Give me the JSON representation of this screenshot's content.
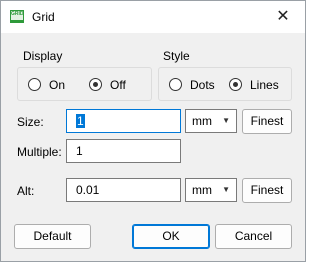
{
  "window": {
    "title": "Grid",
    "close_symbol": "✕",
    "icon_text": "GRID"
  },
  "display": {
    "heading": "Display",
    "option_on": "On",
    "option_off": "Off",
    "selected": "Off"
  },
  "style": {
    "heading": "Style",
    "option_dots": "Dots",
    "option_lines": "Lines",
    "selected": "Lines"
  },
  "size": {
    "label": "Size:",
    "value": "1",
    "unit": "mm",
    "finest_label": "Finest"
  },
  "multiple": {
    "label": "Multiple:",
    "value": "1"
  },
  "alt": {
    "label": "Alt:",
    "value": "0.01",
    "unit": "mm",
    "finest_label": "Finest"
  },
  "buttons": {
    "default_label": "Default",
    "ok_label": "OK",
    "cancel_label": "Cancel"
  },
  "icons": {
    "app": "grid-app-icon",
    "close": "close-icon",
    "dropdown": "chevron-down-icon"
  },
  "colors": {
    "focus_accent": "#0078d7",
    "icon_green": "#2e9a3a"
  }
}
